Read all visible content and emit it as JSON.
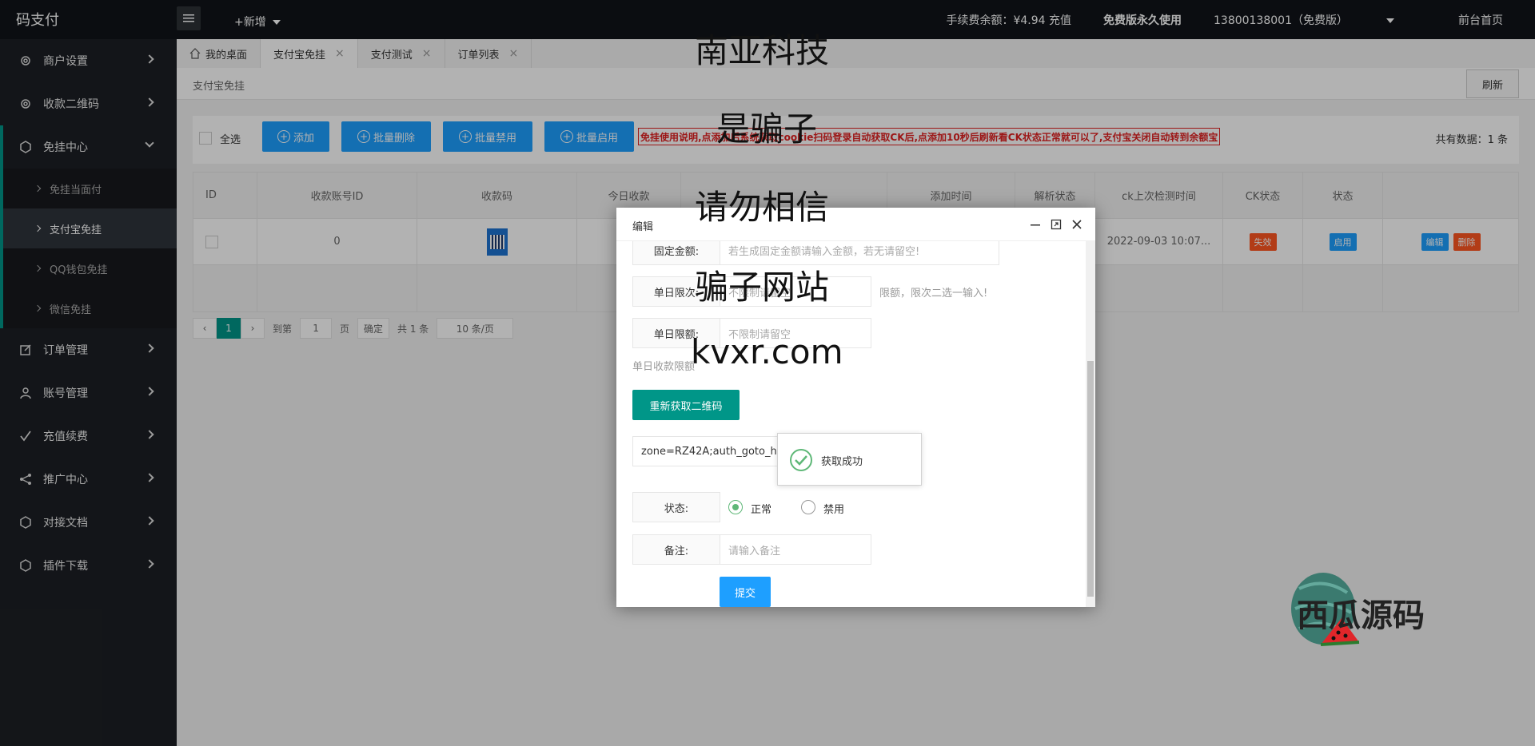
{
  "app": {
    "logo": "码支付",
    "new_label": "+新增"
  },
  "topbar": {
    "balance": "手续费余额：¥4.94 充值",
    "free": "免费版永久使用",
    "account": "13800138001（免费版）",
    "home": "前台首页"
  },
  "sidebar": {
    "items": [
      {
        "label": "商户设置",
        "icon": "gear-icon"
      },
      {
        "label": "收款二维码",
        "icon": "gear-icon"
      },
      {
        "label": "免挂中心",
        "icon": "cube-icon"
      },
      {
        "label": "订单管理",
        "icon": "edit-icon"
      },
      {
        "label": "账号管理",
        "icon": "user-icon"
      },
      {
        "label": "充值续费",
        "icon": "check-icon"
      },
      {
        "label": "推广中心",
        "icon": "share-icon"
      },
      {
        "label": "对接文档",
        "icon": "cube-icon"
      },
      {
        "label": "插件下载",
        "icon": "cube-icon"
      }
    ],
    "sub": [
      "免挂当面付",
      "支付宝免挂",
      "QQ钱包免挂",
      "微信免挂"
    ]
  },
  "tabs": [
    {
      "label": "我的桌面"
    },
    {
      "label": "支付宝免挂"
    },
    {
      "label": "支付测试"
    },
    {
      "label": "订单列表"
    }
  ],
  "content": {
    "breadcrumb": "支付宝免挂",
    "refresh": "刷新",
    "select_all": "全选",
    "buttons": [
      "添加",
      "批量删除",
      "批量禁用",
      "批量启用"
    ],
    "notice": "免挂使用说明,点添加后系统获取cookie扫码登录自动获取CK后,点添加10秒后刷新看CK状态正常就可以了,支付宝关闭自动转到余额宝",
    "total": "共有数据：1 条"
  },
  "table": {
    "headers": [
      "ID",
      "收款账号ID",
      "收款码",
      "今日收款",
      "",
      "添加时间",
      "解析状态",
      "ck上次检测时间",
      "CK状态",
      "状态",
      ""
    ],
    "row": {
      "account_id": "0",
      "check_time": "2022-09-03 10:07...",
      "ck_status": "失效",
      "status": "启用",
      "edit": "编辑",
      "delete": "删除"
    }
  },
  "pager": {
    "current": "1",
    "goto": "到第",
    "page_input": "1",
    "page_unit": "页",
    "confirm": "确定",
    "count": "共 1 条",
    "per_page": "10 条/页"
  },
  "modal": {
    "title": "编辑",
    "fixed_amount_label": "固定金额:",
    "fixed_amount_placeholder": "若生成固定金额请输入金额，若无请留空!",
    "daily_count_label": "单日限次:",
    "daily_count_placeholder": "不限制请留空",
    "daily_count_hint": "限额，限次二选一输入!",
    "daily_limit_label": "单日限额:",
    "daily_limit_placeholder": "不限制请留空",
    "daily_limit_hint": "单日收款限额",
    "regen_button": "重新获取二维码",
    "cookie_value": "zone=RZ42A;auth_goto_http_type=https;JSESSION",
    "status_label": "状态:",
    "status_normal": "正常",
    "status_disabled": "禁用",
    "remark_label": "备注:",
    "remark_placeholder": "请输入备注",
    "submit": "提交",
    "toast": "获取成功"
  },
  "watermarks": [
    "南亚科技",
    "是骗子",
    "请勿相信",
    "骗子网站",
    "kvxr.com"
  ],
  "brand": "西瓜源码",
  "colors": {
    "teal": "#009688",
    "blue": "#1e9fff",
    "red": "#ff5722",
    "dark": "#101419"
  }
}
